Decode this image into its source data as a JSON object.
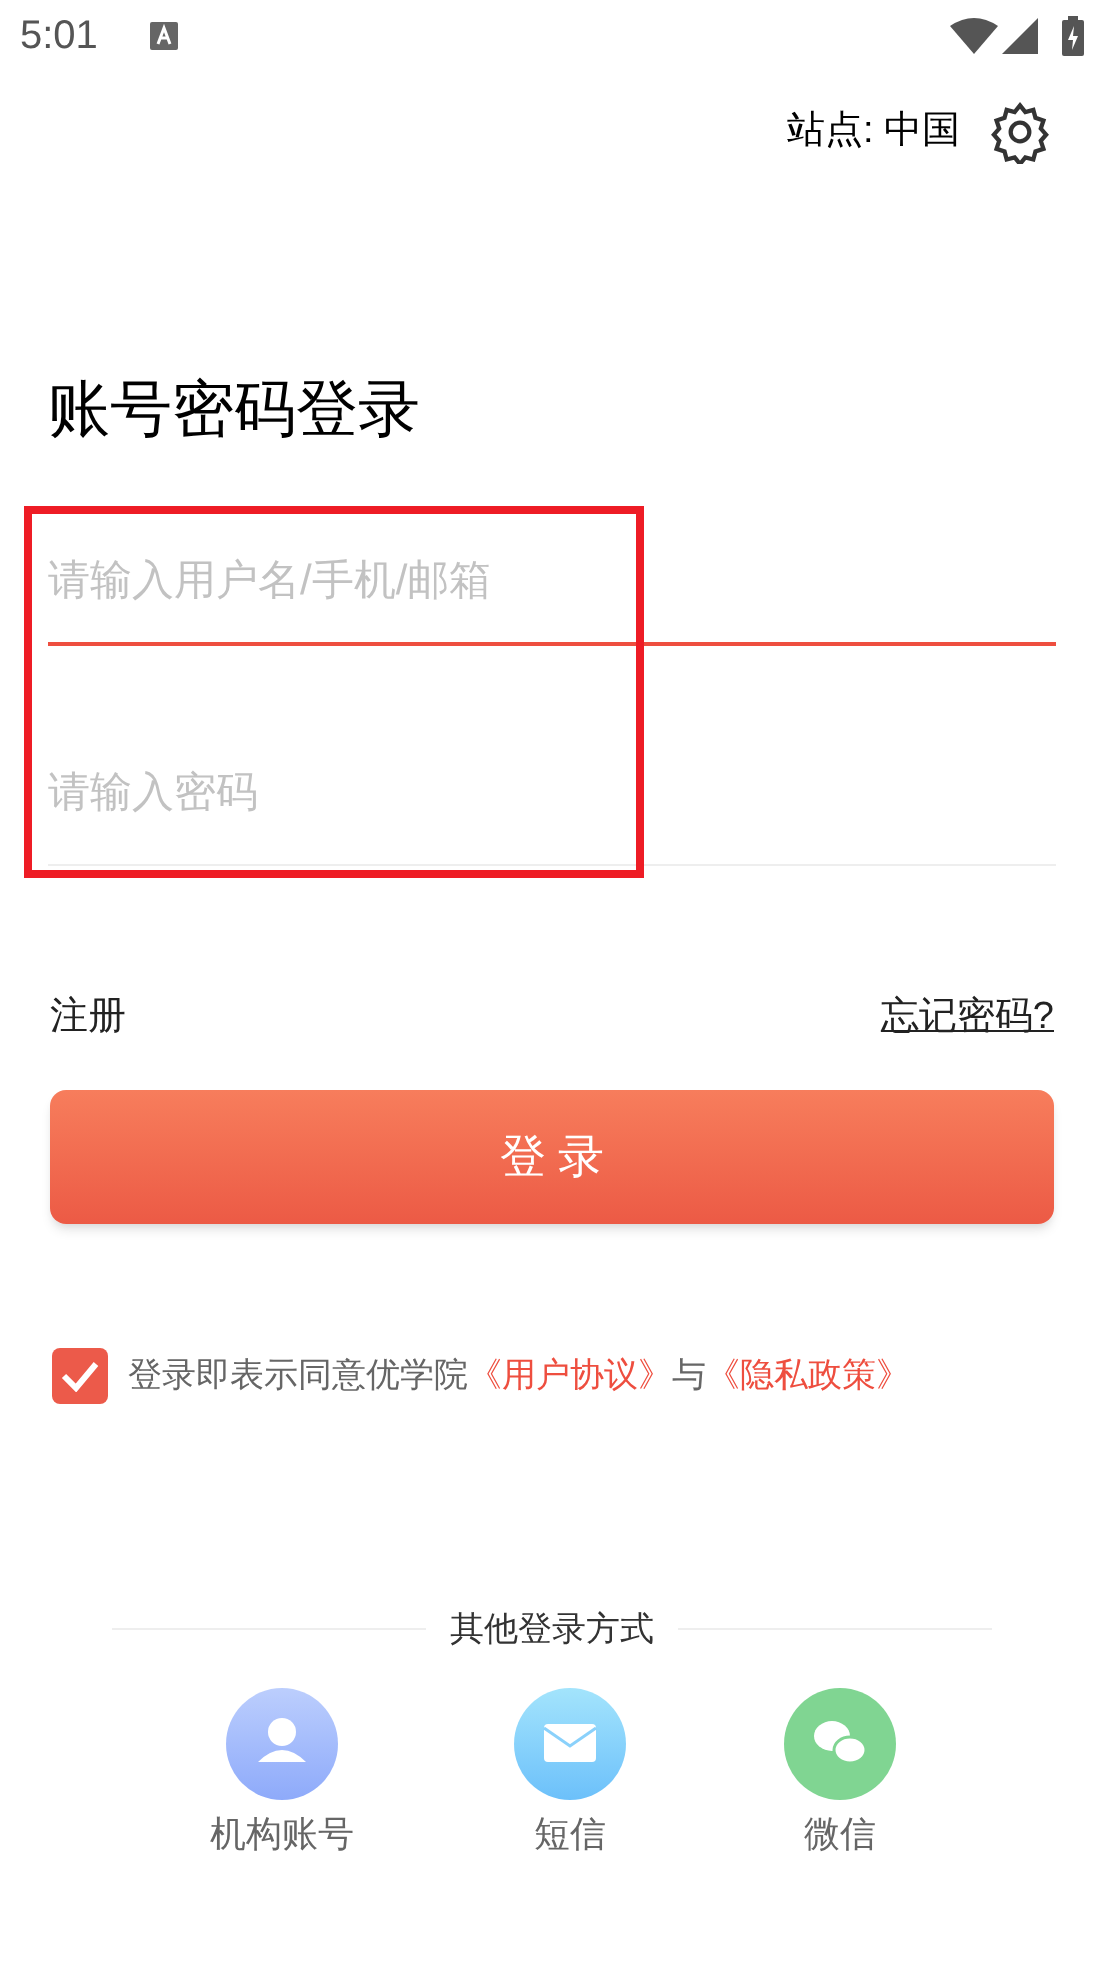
{
  "status_bar": {
    "time": "5:01"
  },
  "site": {
    "label": "站点: 中国"
  },
  "title": "账号密码登录",
  "fields": [
    {
      "placeholder": "请输入用户名/手机/邮箱",
      "focused": true
    },
    {
      "placeholder": "请输入密码",
      "focused": false
    }
  ],
  "register_link": "注册",
  "forgot_link": "忘记密码?",
  "login_button": "登 录",
  "agreement": {
    "checked": true,
    "parts": [
      {
        "text": "登录即表示同意优学院",
        "kind": "plain"
      },
      {
        "text": "《用户协议》",
        "kind": "link"
      },
      {
        "text": "与",
        "kind": "plain"
      },
      {
        "text": "《隐私政策》",
        "kind": "link"
      }
    ]
  },
  "other_login": {
    "heading": "其他登录方式",
    "methods": [
      {
        "label": "机构账号",
        "kind": "person"
      },
      {
        "label": "短信",
        "kind": "mail"
      },
      {
        "label": "微信",
        "kind": "chat"
      }
    ]
  }
}
